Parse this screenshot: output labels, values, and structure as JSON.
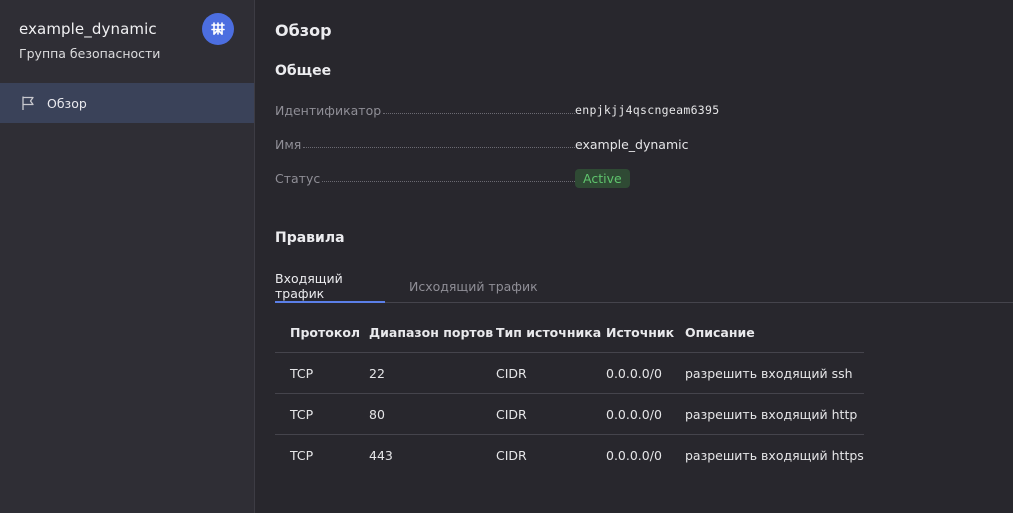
{
  "sidebar": {
    "title": "example_dynamic",
    "subtitle": "Группа безопасности",
    "avatar_icon": "network-icon",
    "avatar_color": "#4c6ee0",
    "nav": [
      {
        "label": "Обзор",
        "icon": "flag-icon",
        "active": true
      }
    ]
  },
  "main": {
    "page_title": "Обзор",
    "general": {
      "title": "Общее",
      "fields": [
        {
          "key": "Идентификатор",
          "value": "enpjkjj4qscngeam6395"
        },
        {
          "key": "Имя",
          "value": "example_dynamic"
        },
        {
          "key": "Статус",
          "value": "Active"
        }
      ]
    },
    "rules": {
      "title": "Правила",
      "tabs": [
        {
          "label": "Входящий трафик",
          "active": true
        },
        {
          "label": "Исходящий трафик",
          "active": false
        }
      ],
      "columns": [
        "Протокол",
        "Диапазон портов",
        "Тип источника",
        "Источник",
        "Описание"
      ],
      "rows": [
        [
          "TCP",
          "22",
          "CIDR",
          "0.0.0.0/0",
          "разрешить входящий ssh"
        ],
        [
          "TCP",
          "80",
          "CIDR",
          "0.0.0.0/0",
          "разрешить входящий http"
        ],
        [
          "TCP",
          "443",
          "CIDR",
          "0.0.0.0/0",
          "разрешить входящий https"
        ]
      ]
    }
  },
  "colors": {
    "accent": "#5b7fe8",
    "status_active_text": "#5fc46d",
    "status_active_bg": "#2f4a34"
  }
}
